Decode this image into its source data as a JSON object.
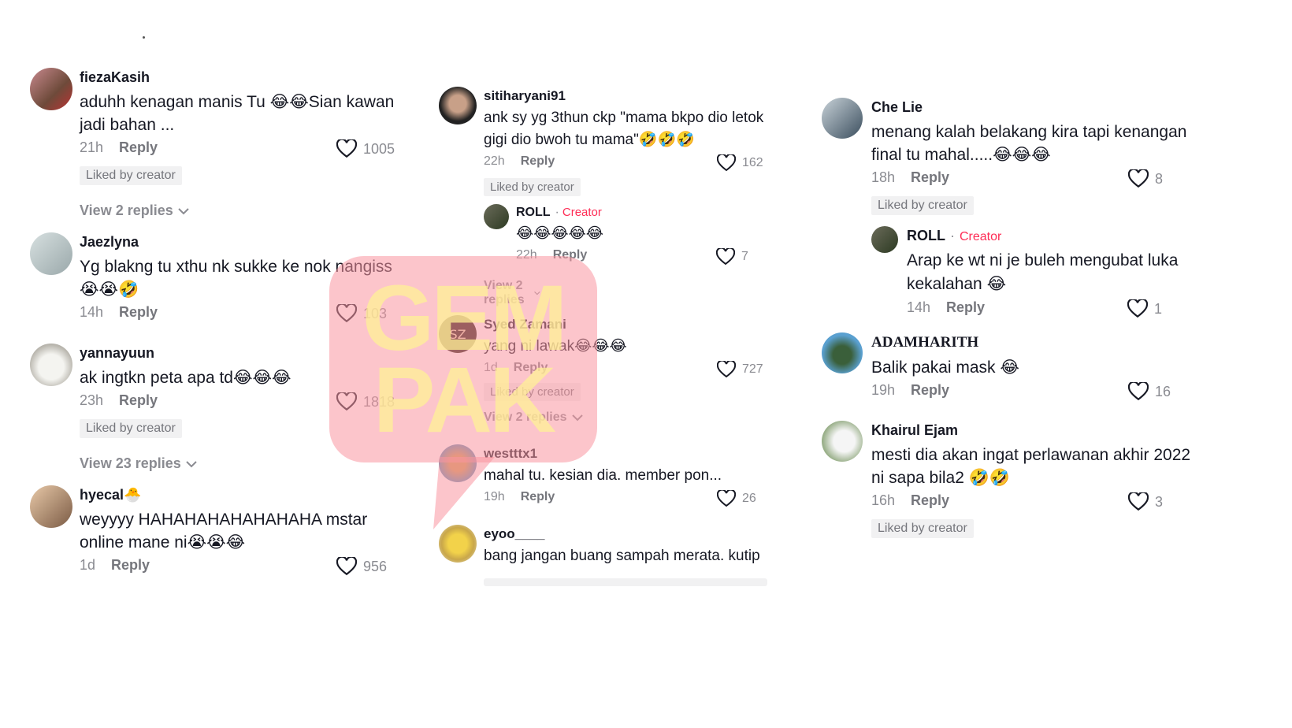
{
  "ui": {
    "reply_label": "Reply",
    "liked_label": "Liked by creator",
    "creator_label": "Creator",
    "accent_creator": "#fe2c55",
    "watermark_lines": [
      "GEM",
      "PAK"
    ]
  },
  "col1": [
    {
      "user": "fiezaKasih",
      "text": "aduhh kenagan manis Tu 😂😂Sian kawan jadi bahan ...",
      "time": "21h",
      "likes": "1005",
      "liked": true,
      "replies": "View 2 replies"
    },
    {
      "user": "Jaezlyna",
      "text": "Yg blakng tu xthu nk sukke ke nok nangiss 😭😭🤣",
      "time": "14h",
      "likes": "103"
    },
    {
      "user": "yannayuun",
      "text": "ak ingtkn peta apa td😂😂😂",
      "time": "23h",
      "likes": "1818",
      "liked": true,
      "replies": "View 23 replies"
    },
    {
      "user": "hyecal🐣",
      "text": "weyyyy HAHAHAHAHAHAHAHA mstar online mane ni😭😭😂",
      "time": "1d",
      "likes": "956"
    }
  ],
  "col2": [
    {
      "user": "sitiharyani91",
      "text": "ank sy yg 3thun ckp \"mama bkpo dio letok gigi dio bwoh tu mama\"🤣🤣🤣",
      "time": "22h",
      "likes": "162",
      "liked": true
    },
    {
      "user": "ROLL",
      "text": "😂😂😂😂😂",
      "time": "22h",
      "likes": "7",
      "replies": "View 2 replies"
    },
    {
      "user": "Syed Zamani",
      "text": "yang ni lawak😂😂😂",
      "time": "1d",
      "likes": "727",
      "liked": true,
      "replies": "View 2 replies"
    },
    {
      "user": "westttx1",
      "text": "mahal tu. kesian dia. member pon...",
      "time": "19h",
      "likes": "26"
    },
    {
      "user": "eyoo____",
      "text": "bang jangan buang sampah merata. kutip"
    }
  ],
  "col3": [
    {
      "user": "Che Lie",
      "text": "menang kalah belakang kira tapi kenangan final tu mahal.....😂😂😂",
      "time": "18h",
      "likes": "8",
      "liked": true
    },
    {
      "user": "ROLL",
      "text": "Arap ke wt ni je buleh mengubat luka kekalahan 😂",
      "time": "14h",
      "likes": "1"
    },
    {
      "user": "ADAMHARITH",
      "text": "Balik pakai mask 😂",
      "time": "19h",
      "likes": "16"
    },
    {
      "user": "Khairul Ejam",
      "text": "mesti dia akan ingat perlawanan akhir 2022 ni sapa bila2 🤣🤣",
      "time": "16h",
      "likes": "3",
      "liked": true
    }
  ]
}
